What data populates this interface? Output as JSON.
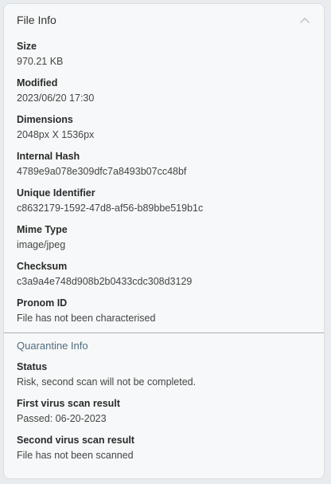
{
  "file_info": {
    "title": "File Info",
    "fields": [
      {
        "label": "Size",
        "value": "970.21 KB"
      },
      {
        "label": "Modified",
        "value": "2023/06/20 17:30"
      },
      {
        "label": "Dimensions",
        "value": "2048px X 1536px"
      },
      {
        "label": "Internal Hash",
        "value": "4789e9a078e309dfc7a8493b07cc48bf"
      },
      {
        "label": "Unique Identifier",
        "value": "c8632179-1592-47d8-af56-b89bbe519b1c"
      },
      {
        "label": "Mime Type",
        "value": "image/jpeg"
      },
      {
        "label": "Checksum",
        "value": "c3a9a4e748d908b2b0433cdc308d3129"
      },
      {
        "label": "Pronom ID",
        "value": "File has not been characterised"
      }
    ]
  },
  "quarantine_info": {
    "title": "Quarantine Info",
    "fields": [
      {
        "label": "Status",
        "value": "Risk, second scan will not be completed."
      },
      {
        "label": "First virus scan result",
        "value": "Passed: 06-20-2023"
      },
      {
        "label": "Second virus scan result",
        "value": "File has not been scanned"
      }
    ]
  },
  "icons": {
    "collapse": "chevron-up-icon"
  },
  "colors": {
    "background": "#e9ecef",
    "card": "#f7f8f9",
    "section_title": "#4f6d80"
  }
}
